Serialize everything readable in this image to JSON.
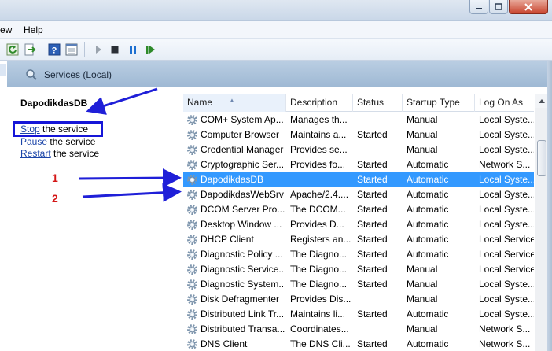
{
  "menu": {
    "view_label": "ew",
    "help_label": "Help"
  },
  "panel": {
    "title": "Services (Local)"
  },
  "details": {
    "service_name": "DapodikdasDB",
    "stop_link": "Stop",
    "stop_rest": " the service",
    "pause_link": "Pause",
    "pause_rest": " the service",
    "restart_link": "Restart",
    "restart_rest": " the service"
  },
  "columns": {
    "name": "Name",
    "description": "Description",
    "status": "Status",
    "startup_type": "Startup Type",
    "log_on_as": "Log On As"
  },
  "services": [
    {
      "name": "COM+ System Ap...",
      "description": "Manages th...",
      "status": "",
      "startup_type": "Manual",
      "log_on_as": "Local Syste..."
    },
    {
      "name": "Computer Browser",
      "description": "Maintains a...",
      "status": "Started",
      "startup_type": "Manual",
      "log_on_as": "Local Syste..."
    },
    {
      "name": "Credential Manager",
      "description": "Provides se...",
      "status": "",
      "startup_type": "Manual",
      "log_on_as": "Local Syste..."
    },
    {
      "name": "Cryptographic Ser...",
      "description": "Provides fo...",
      "status": "Started",
      "startup_type": "Automatic",
      "log_on_as": "Network S..."
    },
    {
      "name": "DapodikdasDB",
      "description": "",
      "status": "Started",
      "startup_type": "Automatic",
      "log_on_as": "Local Syste..."
    },
    {
      "name": "DapodikdasWebSrv",
      "description": "Apache/2.4....",
      "status": "Started",
      "startup_type": "Automatic",
      "log_on_as": "Local Syste..."
    },
    {
      "name": "DCOM Server Pro...",
      "description": "The DCOM...",
      "status": "Started",
      "startup_type": "Automatic",
      "log_on_as": "Local Syste..."
    },
    {
      "name": "Desktop Window ...",
      "description": "Provides D...",
      "status": "Started",
      "startup_type": "Automatic",
      "log_on_as": "Local Syste..."
    },
    {
      "name": "DHCP Client",
      "description": "Registers an...",
      "status": "Started",
      "startup_type": "Automatic",
      "log_on_as": "Local Service"
    },
    {
      "name": "Diagnostic Policy ...",
      "description": "The Diagno...",
      "status": "Started",
      "startup_type": "Automatic",
      "log_on_as": "Local Service"
    },
    {
      "name": "Diagnostic Service...",
      "description": "The Diagno...",
      "status": "Started",
      "startup_type": "Manual",
      "log_on_as": "Local Service"
    },
    {
      "name": "Diagnostic System...",
      "description": "The Diagno...",
      "status": "Started",
      "startup_type": "Manual",
      "log_on_as": "Local Syste..."
    },
    {
      "name": "Disk Defragmenter",
      "description": "Provides Dis...",
      "status": "",
      "startup_type": "Manual",
      "log_on_as": "Local Syste..."
    },
    {
      "name": "Distributed Link Tr...",
      "description": "Maintains li...",
      "status": "Started",
      "startup_type": "Automatic",
      "log_on_as": "Local Syste..."
    },
    {
      "name": "Distributed Transa...",
      "description": "Coordinates...",
      "status": "",
      "startup_type": "Manual",
      "log_on_as": "Network S..."
    },
    {
      "name": "DNS Client",
      "description": "The DNS Cli...",
      "status": "Started",
      "startup_type": "Automatic",
      "log_on_as": "Network S..."
    }
  ],
  "selected_service": "DapodikdasDB",
  "annotations": {
    "label_1": "1",
    "label_2": "2"
  },
  "colors": {
    "selection": "#3399ff",
    "arrow": "#1f1fd8",
    "annotation_number": "#d41616",
    "header_band": "#a9c2db"
  }
}
